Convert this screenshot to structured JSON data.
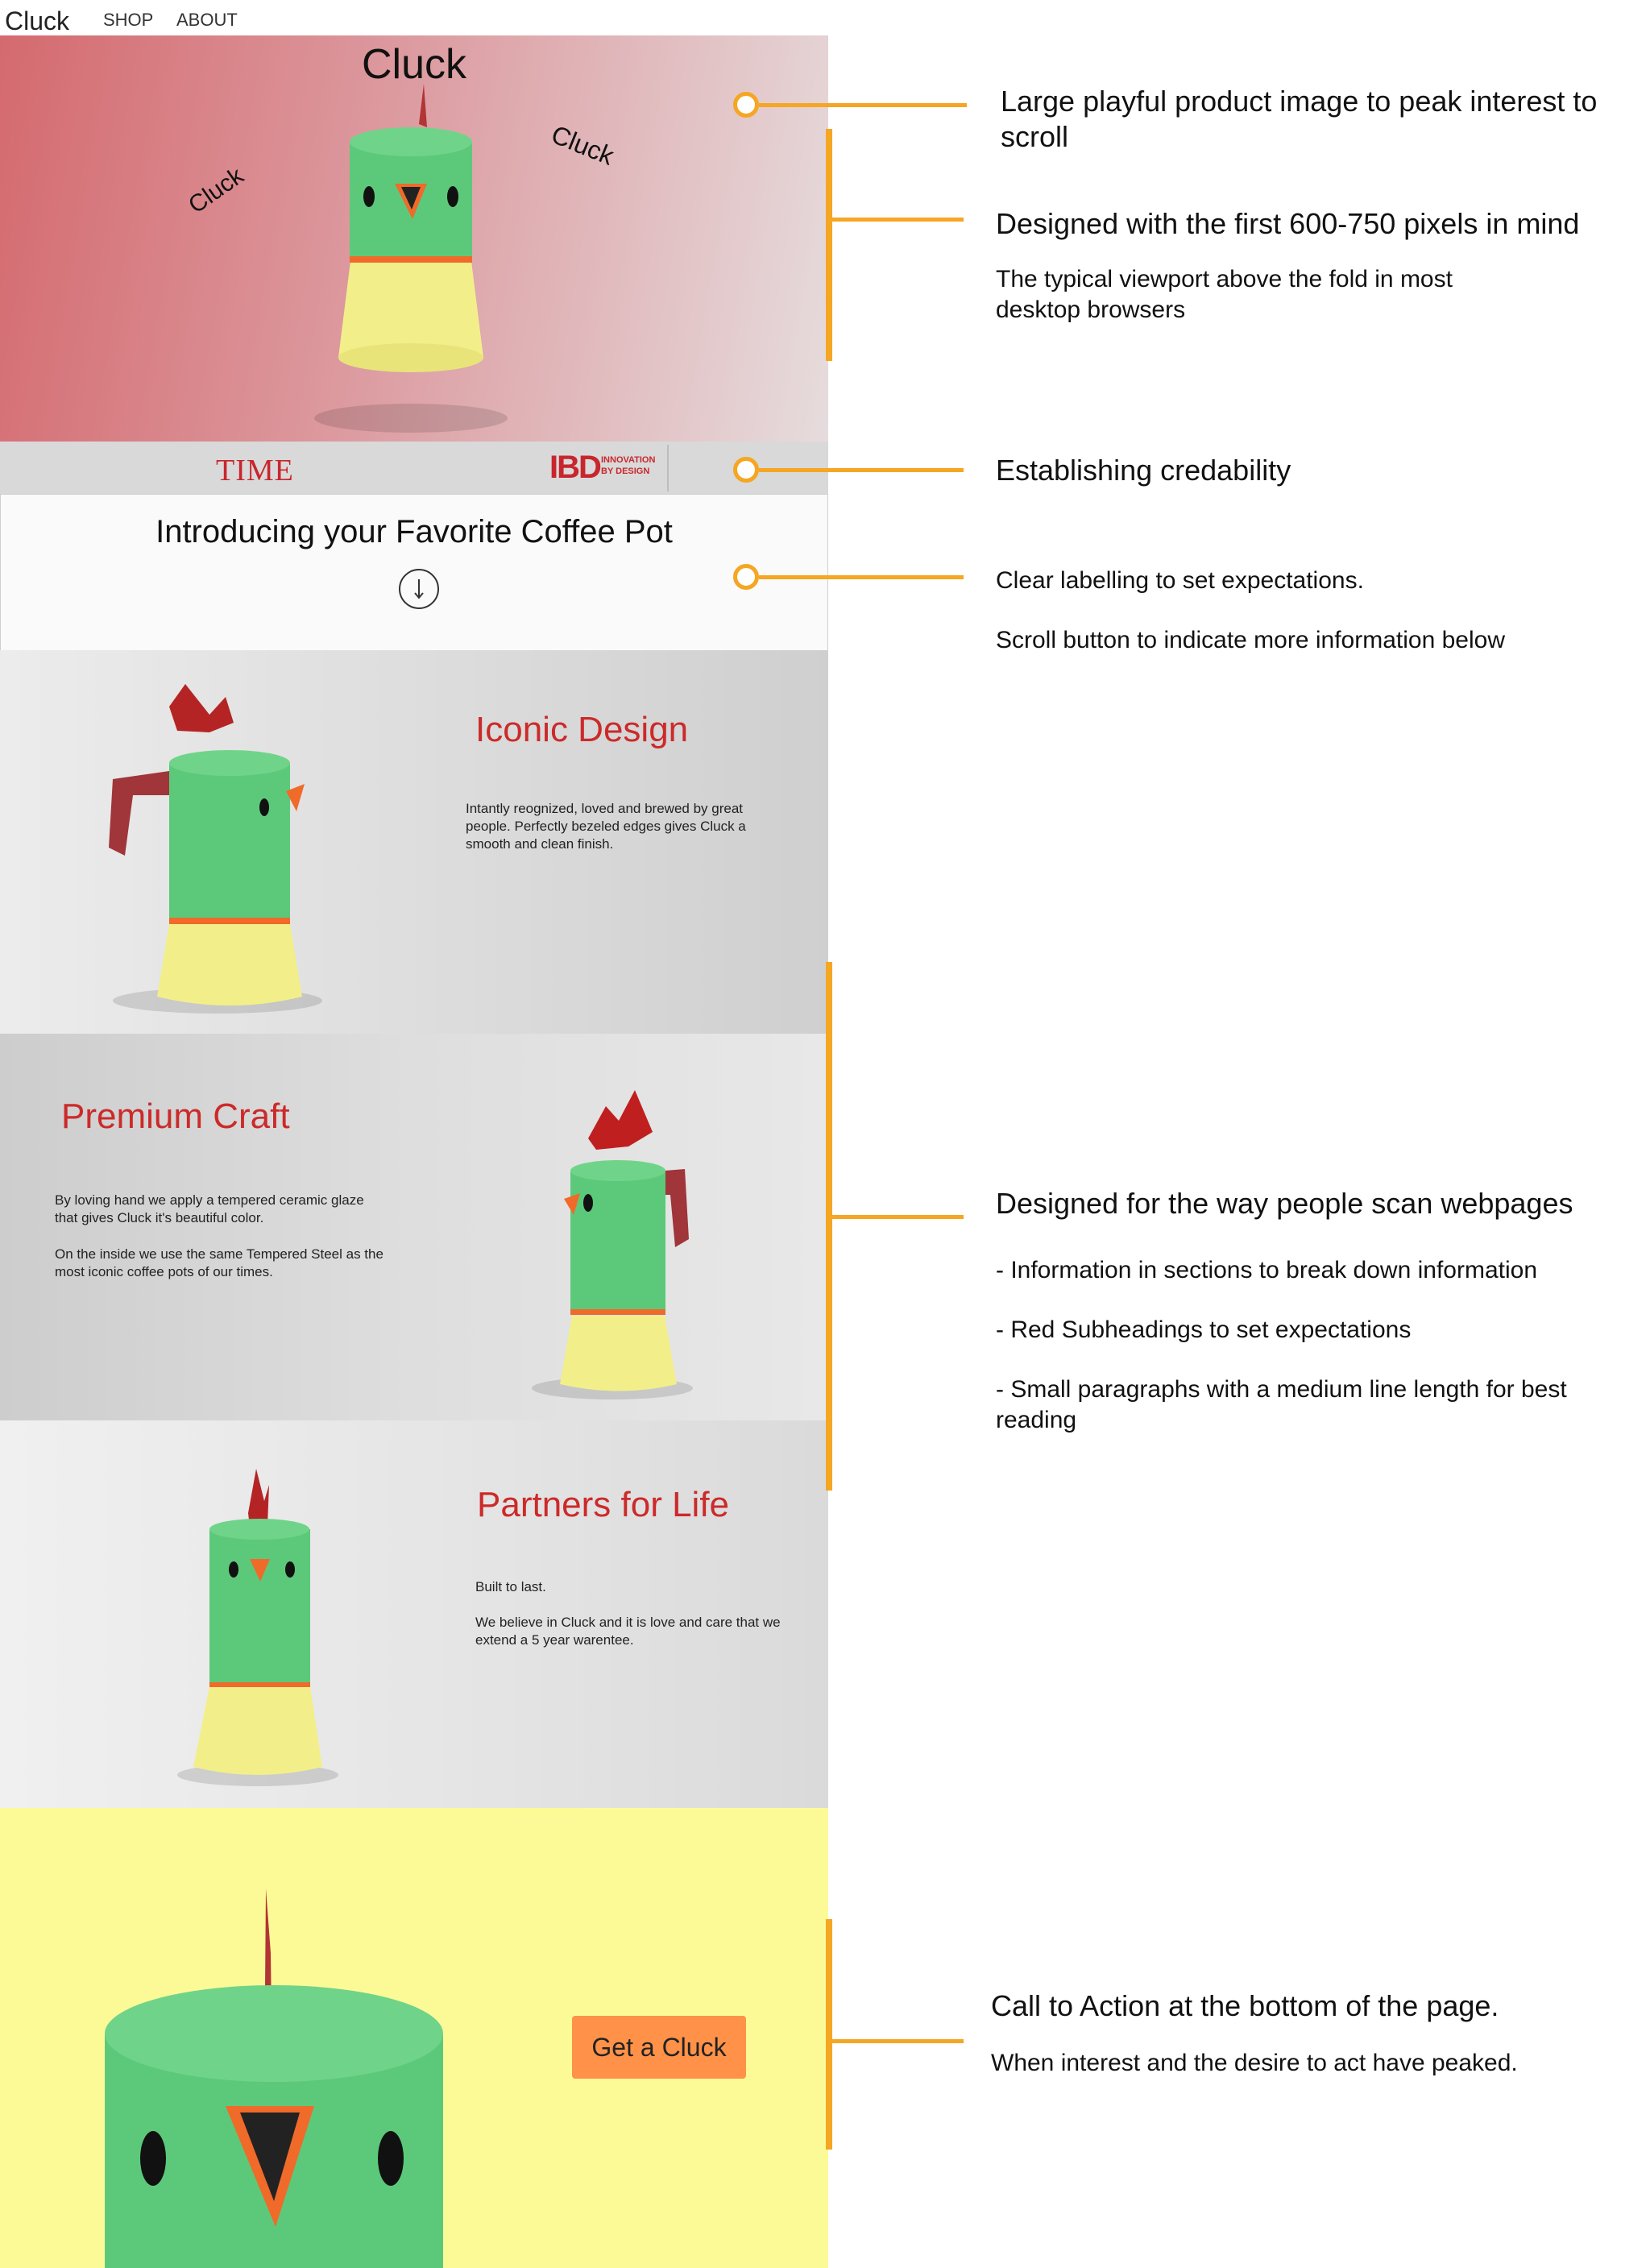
{
  "nav": {
    "brand": "Cluck",
    "shop": "SHOP",
    "about": "ABOUT"
  },
  "hero": {
    "title": "Cluck",
    "word_left": "Cluck",
    "word_right": "Cluck"
  },
  "logos": {
    "time": "TIME",
    "ibd_mark": "IBD",
    "ibd_line1": "INNOVATION",
    "ibd_line2": "BY DESIGN"
  },
  "intro": {
    "title": "Introducing your Favorite Coffee Pot",
    "scroll_icon": "arrow-down-circle-icon"
  },
  "sections": {
    "iconic": {
      "heading": "Iconic Design",
      "body": "Intantly reognized, loved and brewed by great people. Perfectly bezeled edges gives Cluck a smooth and clean finish."
    },
    "premium": {
      "heading": "Premium Craft",
      "p1": "By loving hand we apply a tempered ceramic glaze that gives Cluck it's beautiful color.",
      "p2": "On the inside we use the same Tempered Steel as the most iconic coffee pots of our times."
    },
    "partners": {
      "heading": "Partners for Life",
      "p1": "Built to last.",
      "p2": "We believe in Cluck and it is love and care that we extend a 5 year warentee."
    }
  },
  "cta": {
    "label": "Get a Cluck"
  },
  "annotations": {
    "a1": "Large playful product image to peak interest to scroll",
    "a2_head": "Designed with the first 600-750 pixels in mind",
    "a2_sub": "The typical viewport above the fold in most desktop browsers",
    "a3": "Establishing credability",
    "a4_1": "Clear labelling to set expectations.",
    "a4_2": "Scroll button to indicate more information below",
    "a5_head": "Designed for the way people scan webpages",
    "a5_b1": "- Information in sections to break down information",
    "a5_b2": "- Red Subheadings to set expectations",
    "a5_b3": "- Small paragraphs with a medium line length for best reading",
    "a6_head": "Call to Action at the bottom of the page.",
    "a6_sub": "When interest and the desire to act have peaked."
  },
  "colors": {
    "accent_orange": "#f5a623",
    "heading_red": "#cc2a2a",
    "pot_green": "#5cc97a",
    "pot_yellow": "#f2ef8a",
    "cta_orange": "#ff9248",
    "cta_section_yellow": "#fcfa96"
  }
}
